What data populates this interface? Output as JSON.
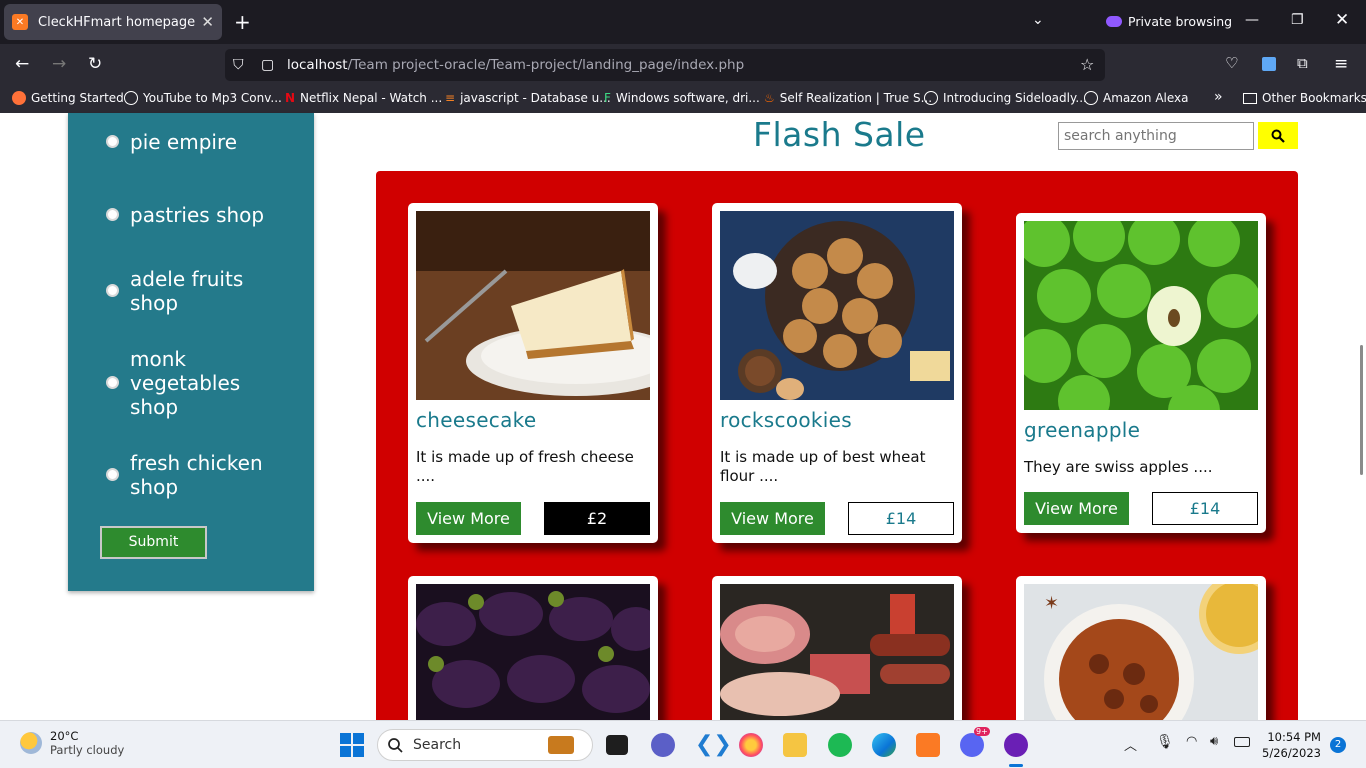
{
  "browser": {
    "tab_title": "CleckHFmart homepage",
    "private_label": "Private browsing",
    "url_host": "localhost",
    "url_path": "/Team project-oracle/Team-project/landing_page/index.php",
    "bookmarks": [
      "Getting Started",
      "YouTube to Mp3 Conv...",
      "Netflix Nepal - Watch ...",
      "javascript - Database u...",
      "Windows software, dri...",
      "Self Realization | True S...",
      "Introducing Sideloadly...",
      "Amazon Alexa"
    ],
    "other_bookmarks": "Other Bookmarks"
  },
  "sidebar": {
    "shops": [
      "pie empire",
      "pastries shop",
      "adele fruits shop",
      "monk vegetables shop",
      "fresh chicken shop"
    ],
    "submit_label": "Submit"
  },
  "main": {
    "title": "Flash Sale",
    "search_placeholder": "search anything",
    "products": [
      {
        "name": "cheesecake",
        "desc": "It is made up of fresh cheese ....",
        "view_label": "View More",
        "price": "£2"
      },
      {
        "name": "rockscookies",
        "desc": "It is made up of best wheat flour ....",
        "view_label": "View More",
        "price": "£14"
      },
      {
        "name": "greenapple",
        "desc": "They are swiss apples ....",
        "view_label": "View More",
        "price": "£14"
      }
    ]
  },
  "taskbar": {
    "temp": "20°C",
    "weather": "Partly cloudy",
    "search_label": "Search",
    "time": "10:54 PM",
    "date": "5/26/2023",
    "notif_count": "2",
    "discord_badge": "9+"
  },
  "colors": {
    "accent": "#1a7a8c",
    "panel": "#d00000",
    "sidebar": "#247a8b",
    "green": "#2e8b2e"
  }
}
